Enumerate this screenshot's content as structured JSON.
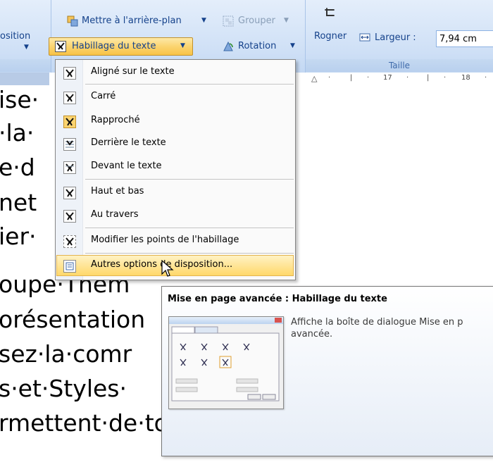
{
  "ribbon": {
    "disposition_label": "osition",
    "arriere_plan_label": "Mettre à l'arrière-plan",
    "grouper_label": "Grouper",
    "habillage_label": "Habillage du texte",
    "rotation_label": "Rotation",
    "rogner_label": "Rogner",
    "largeur_label": "Largeur :",
    "largeur_value": "7,94 cm",
    "taille_label": "Taille"
  },
  "ruler": {
    "ticks": [
      "17",
      "18"
    ]
  },
  "document": {
    "lines": [
      "ise·",
      "·la·",
      "e·d",
      "net",
      "ier·",
      "oupe·Thèm",
      "orésentation",
      "sez·la·comr",
      "s·et·Styles·",
      "rmettent·de·toujours·"
    ]
  },
  "menu": {
    "items": [
      {
        "label": "Aligné sur le texte",
        "active": false
      },
      {
        "label": "Carré",
        "active": false
      },
      {
        "label": "Rapproché",
        "active": true
      },
      {
        "label": "Derrière le texte",
        "active": false
      },
      {
        "label": "Devant le texte",
        "active": false
      },
      {
        "label": "Haut et bas",
        "active": false
      },
      {
        "label": "Au travers",
        "active": false
      },
      {
        "label": "Modifier les points de l'habillage",
        "active": false
      },
      {
        "label": "Autres options de disposition...",
        "active": false,
        "hover": true
      }
    ]
  },
  "tooltip": {
    "title": "Mise en page avancée : Habillage du texte",
    "description": "Affiche la boîte de dialogue Mise en p\navancée."
  },
  "colors": {
    "ribbon_bg": "#cfe0f6",
    "hover_gold": "#fbd470",
    "label_blue": "#15428b"
  }
}
